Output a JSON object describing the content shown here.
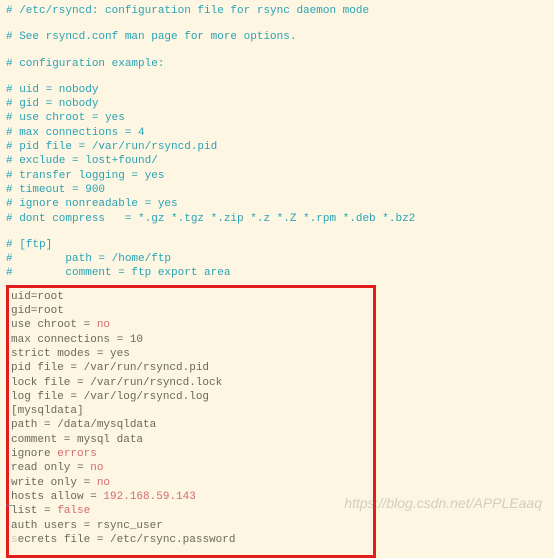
{
  "comments": {
    "l1": "# /etc/rsyncd: configuration file for rsync daemon mode",
    "l2": "# See rsyncd.conf man page for more options.",
    "l3": "# configuration example:",
    "l4": "# uid = nobody",
    "l5": "# gid = nobody",
    "l6": "# use chroot = yes",
    "l7": "# max connections = 4",
    "l8": "# pid file = /var/run/rsyncd.pid",
    "l9": "# exclude = lost+found/",
    "l10": "# transfer logging = yes",
    "l11": "# timeout = 900",
    "l12": "# ignore nonreadable = yes",
    "l13": "# dont compress   = *.gz *.tgz *.zip *.z *.Z *.rpm *.deb *.bz2",
    "l14": "# [ftp]",
    "l15": "#        path = /home/ftp",
    "l16": "#        comment = ftp export area"
  },
  "config": {
    "uid": "uid=root",
    "gid": "gid=root",
    "use_chroot_k": "use chroot = ",
    "use_chroot_v": "no",
    "max_connections": "max connections = 10",
    "strict_modes": "strict modes = yes",
    "pid_file": "pid file = /var/run/rsyncd.pid",
    "lock_file": "lock file = /var/run/rsyncd.lock",
    "log_file": "log file = /var/log/rsyncd.log",
    "section": "[mysqldata]",
    "path": "path = /data/mysqldata",
    "comment_line": "comment = mysql data",
    "ignore_k": "ignore ",
    "ignore_v": "errors",
    "read_only_k": "read only = ",
    "read_only_v": "no",
    "write_only_k": "write only = ",
    "write_only_v": "no",
    "hosts_allow_k": "hosts allow = ",
    "hosts_allow_v": "192.168.59.143",
    "list_k": "list = ",
    "list_v": "false",
    "auth_users": "auth users = rsync_user",
    "secrets_file_prefix": "s",
    "secrets_file": "ecrets file = /etc/rsync.password"
  },
  "watermark": "https://blog.csdn.net/APPLEaaq",
  "tilde": "~"
}
